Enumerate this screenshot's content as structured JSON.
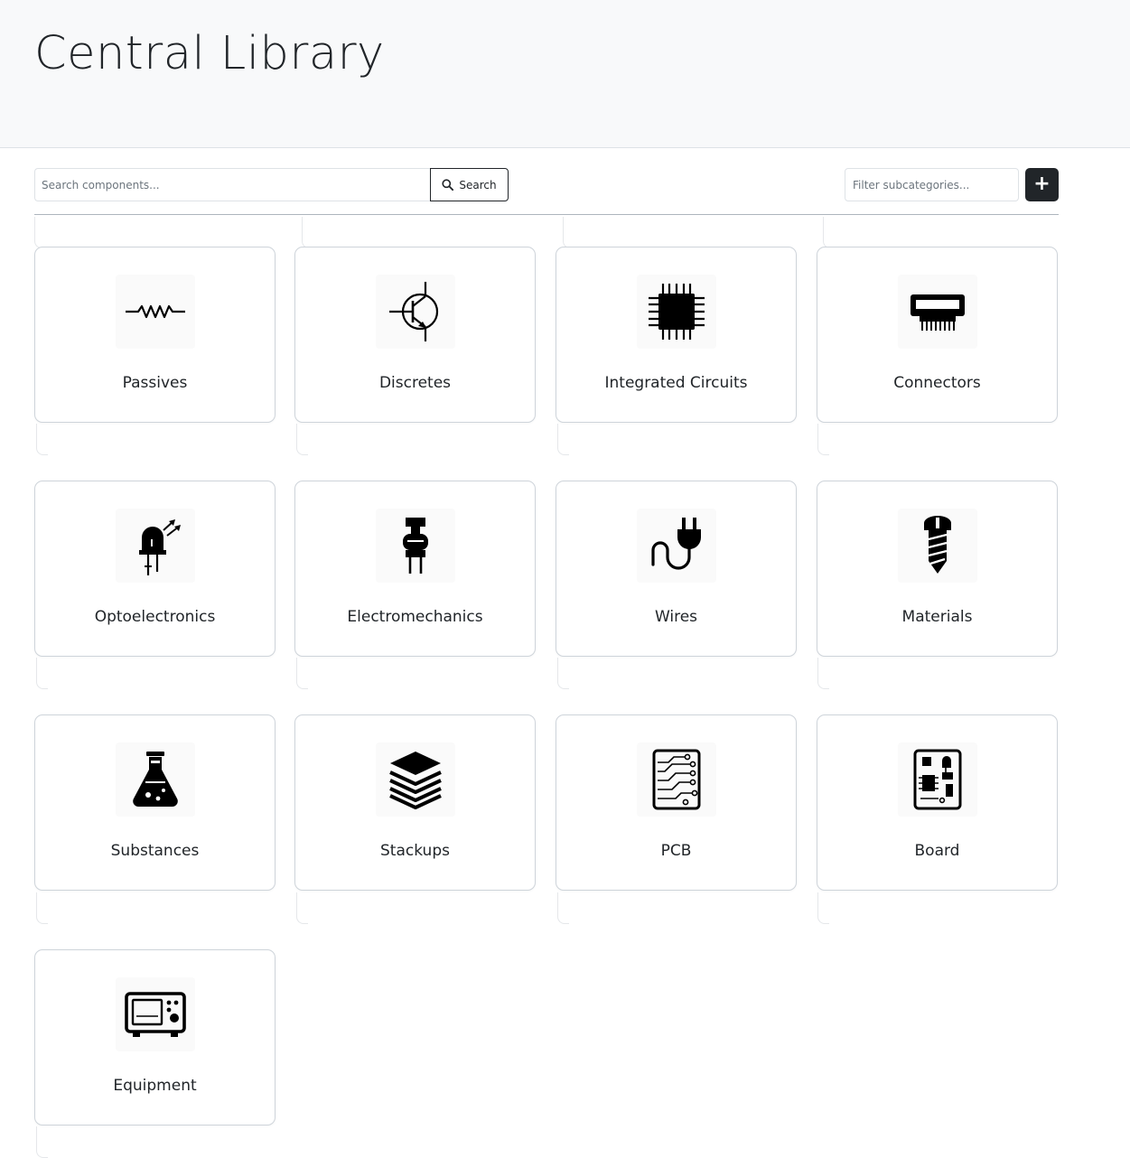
{
  "page": {
    "title": "Central Library"
  },
  "toolbar": {
    "search_placeholder": "Search components...",
    "search_label": "Search",
    "filter_placeholder": "Filter subcategories...",
    "add_label": "+"
  },
  "categories": [
    {
      "label": "Passives",
      "icon": "resistor-icon"
    },
    {
      "label": "Discretes",
      "icon": "transistor-icon"
    },
    {
      "label": "Integrated Circuits",
      "icon": "chip-icon"
    },
    {
      "label": "Connectors",
      "icon": "connector-icon"
    },
    {
      "label": "Optoelectronics",
      "icon": "led-icon"
    },
    {
      "label": "Electromechanics",
      "icon": "relay-icon"
    },
    {
      "label": "Wires",
      "icon": "plug-icon"
    },
    {
      "label": "Materials",
      "icon": "screw-icon"
    },
    {
      "label": "Substances",
      "icon": "flask-icon"
    },
    {
      "label": "Stackups",
      "icon": "layers-icon"
    },
    {
      "label": "PCB",
      "icon": "pcb-icon"
    },
    {
      "label": "Board",
      "icon": "board-icon"
    },
    {
      "label": "Equipment",
      "icon": "oscilloscope-icon"
    }
  ]
}
